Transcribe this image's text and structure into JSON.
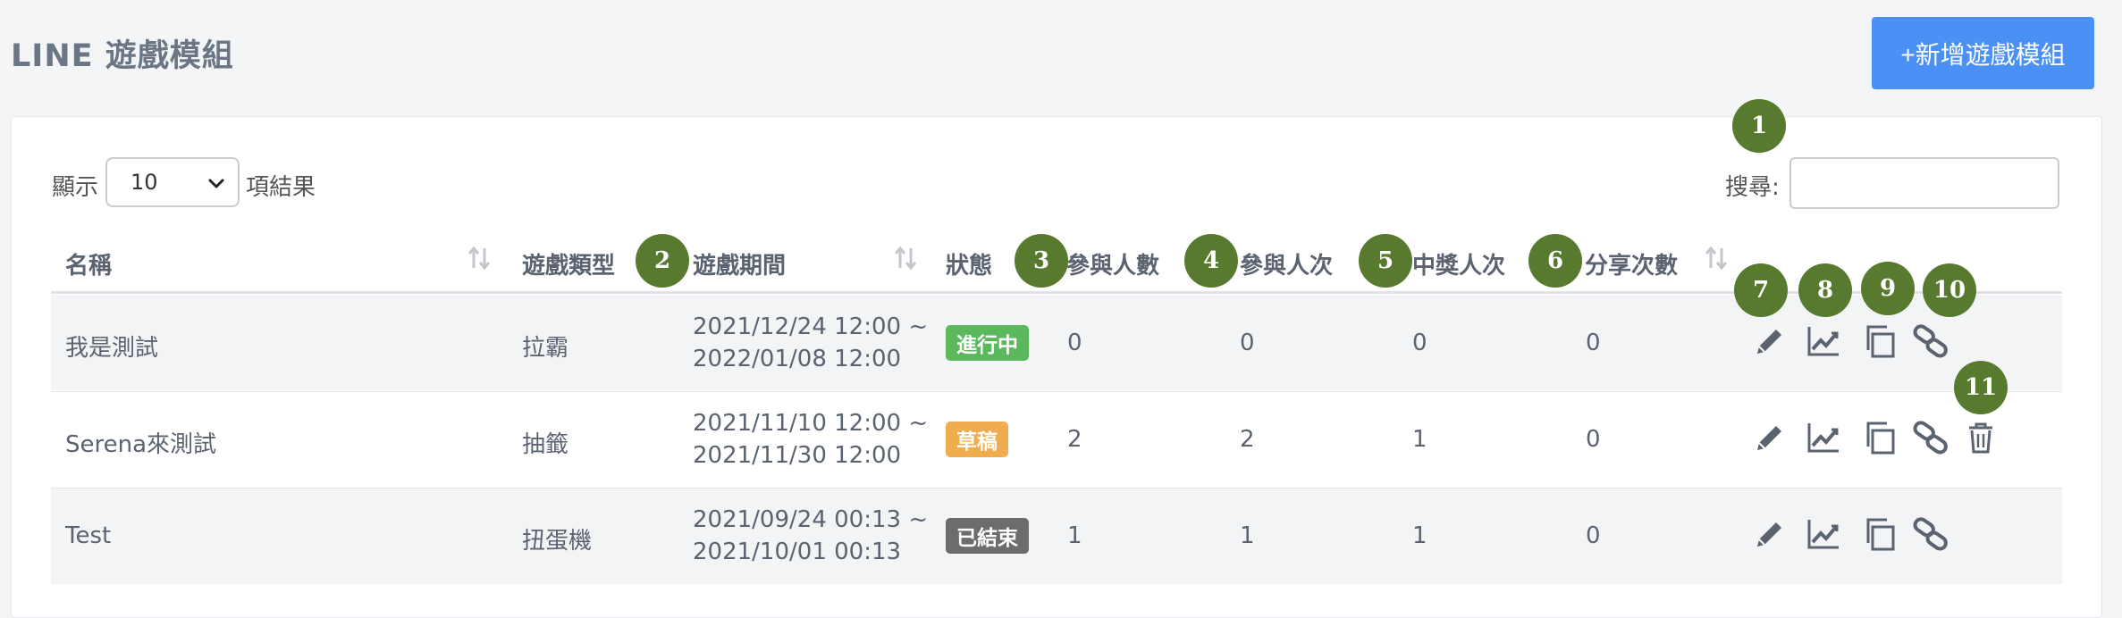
{
  "page": {
    "title": "LINE 遊戲模組",
    "add_button": "+新增遊戲模組"
  },
  "controls": {
    "show_label": "顯示",
    "page_length": "10",
    "results_label": "項結果",
    "search_label": "搜尋:",
    "search_value": ""
  },
  "table": {
    "headers": {
      "name": "名稱",
      "type": "遊戲類型",
      "period": "遊戲期間",
      "status": "狀態",
      "participants": "參與人數",
      "participations": "參與人次",
      "winners": "中獎人次",
      "shares": "分享次數"
    },
    "rows": [
      {
        "name": "我是測試",
        "type": "拉霸",
        "period_start": "2021/12/24 12:00 ~",
        "period_end": "2022/01/08 12:00",
        "status": "進行中",
        "status_color": "#5cb85c",
        "participants": "0",
        "participations": "0",
        "winners": "0",
        "shares": "0"
      },
      {
        "name": "Serena來測試",
        "type": "抽籤",
        "period_start": "2021/11/10 12:00 ~",
        "period_end": "2021/11/30 12:00",
        "status": "草稿",
        "status_color": "#f0ad4e",
        "participants": "2",
        "participations": "2",
        "winners": "1",
        "shares": "0"
      },
      {
        "name": "Test",
        "type": "扭蛋機",
        "period_start": "2021/09/24 00:13 ~",
        "period_end": "2021/10/01 00:13",
        "status": "已結束",
        "status_color": "#6c6c6c",
        "participants": "1",
        "participations": "1",
        "winners": "1",
        "shares": "0"
      }
    ]
  },
  "markers": [
    "1",
    "2",
    "3",
    "4",
    "5",
    "6",
    "7",
    "8",
    "9",
    "10",
    "11"
  ],
  "icons": {
    "edit": "pencil-icon",
    "stats": "chart-line-icon",
    "copy": "copy-icon",
    "link": "link-icon",
    "delete": "trash-icon",
    "sort": "sort-icon"
  },
  "colors": {
    "primary": "#4a90f5",
    "marker": "#577a2e",
    "icon": "#5b6371"
  }
}
